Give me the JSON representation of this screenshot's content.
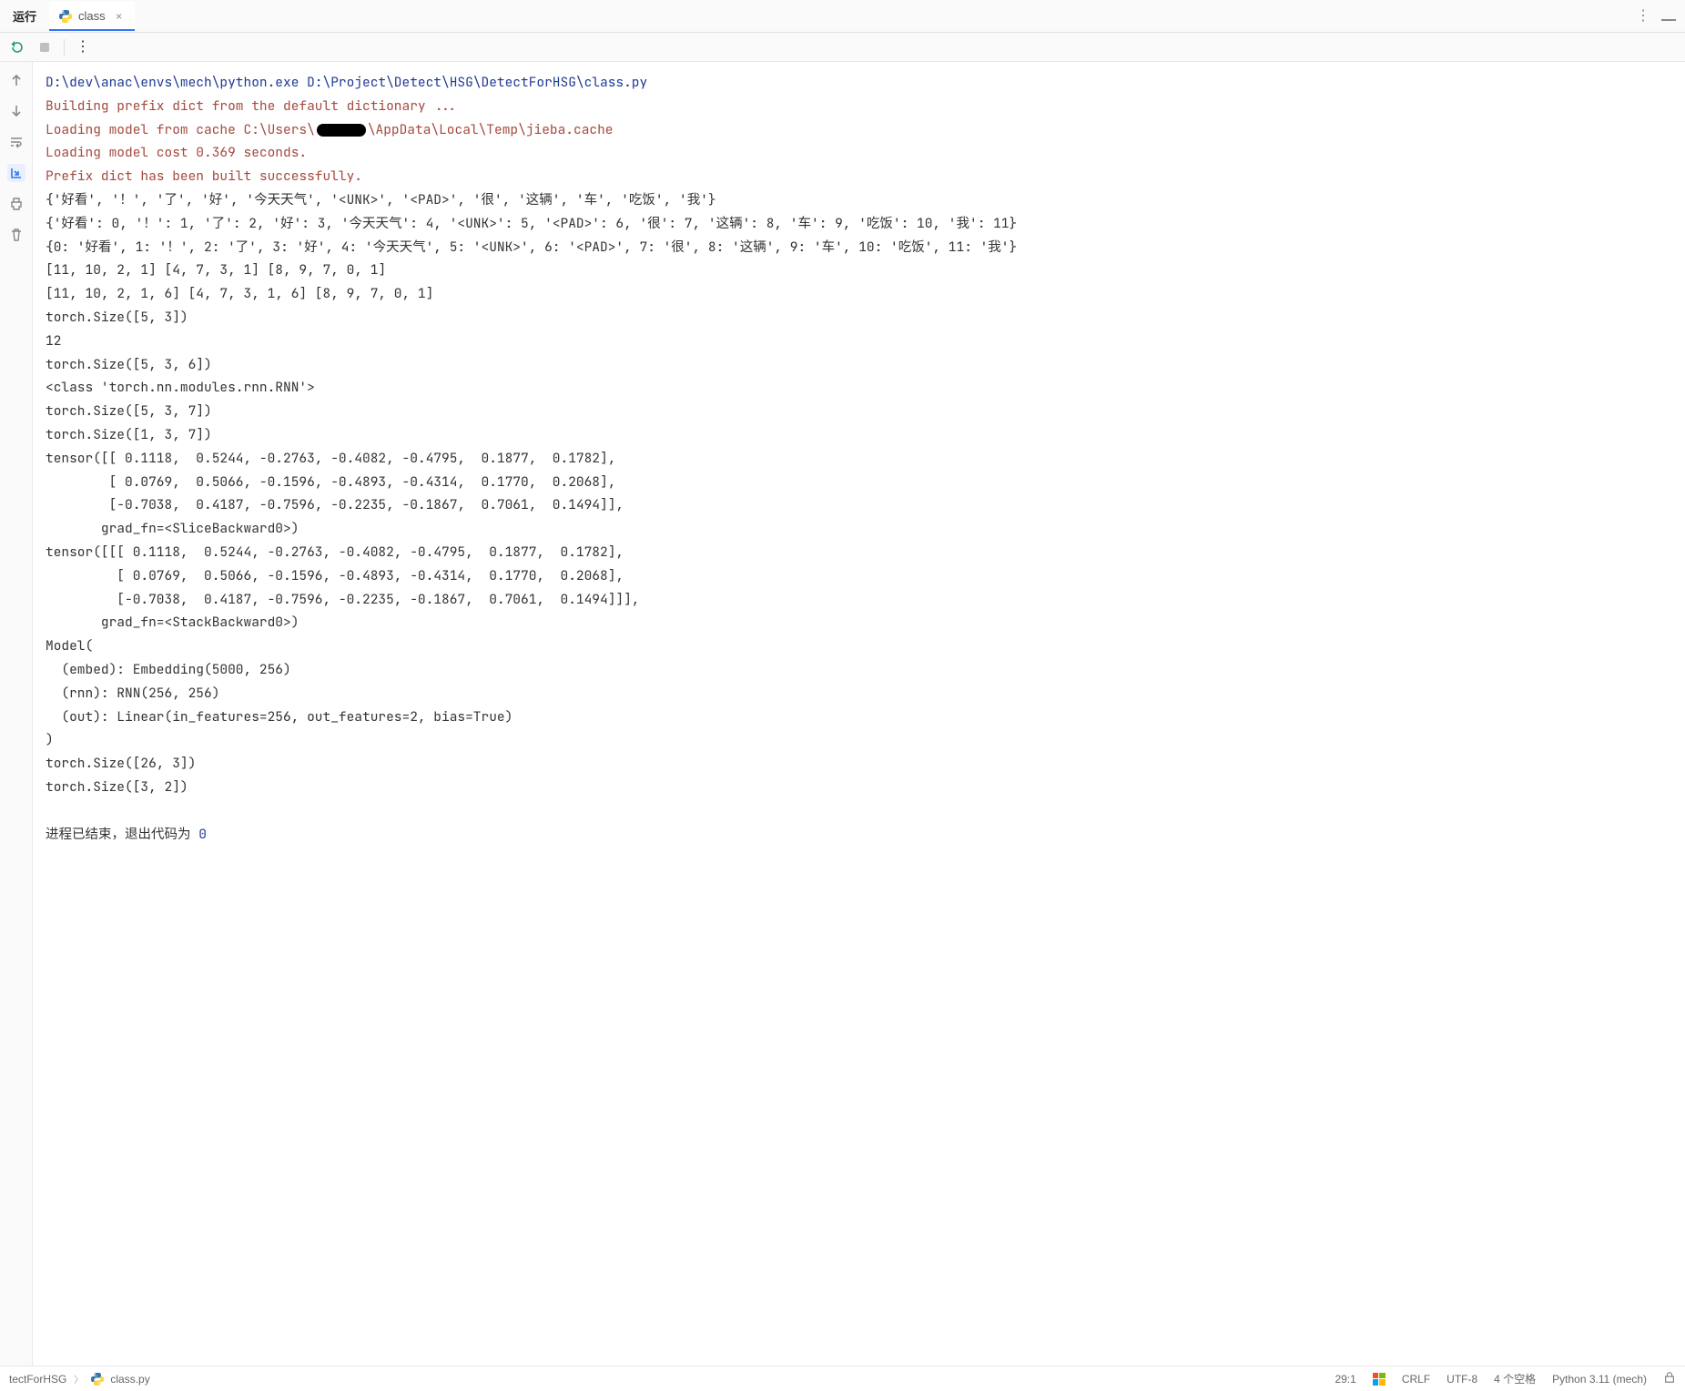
{
  "tabbar": {
    "run_label": "运行",
    "tab": {
      "title": "class",
      "close_glyph": "×"
    },
    "more_glyph": "⋮",
    "minimize_title": "—"
  },
  "toolbar": {
    "rerun_title": "Rerun",
    "stop_title": "Stop",
    "more_glyph": "⋮"
  },
  "gutter": {
    "up_title": "↑",
    "down_title": "↓",
    "wrap_title": "Soft-wrap",
    "scroll_title": "Scroll to end",
    "print_title": "Print",
    "delete_title": "Delete"
  },
  "console": {
    "cmd": "D:\\dev\\anac\\envs\\mech\\python.exe D:\\Project\\Detect\\HSG\\DetectForHSG\\class.py",
    "warn1": "Building prefix dict from the default dictionary ...",
    "warn2a": "Loading model from cache C:\\Users\\",
    "warn2b": "\\AppData\\Local\\Temp\\jieba.cache",
    "warn3": "Loading model cost 0.369 seconds.",
    "warn4": "Prefix dict has been built successfully.",
    "out": [
      "{'好看', '！', '了', '好', '今天天气', '<UNK>', '<PAD>', '很', '这辆', '车', '吃饭', '我'}",
      "{'好看': 0, '！': 1, '了': 2, '好': 3, '今天天气': 4, '<UNK>': 5, '<PAD>': 6, '很': 7, '这辆': 8, '车': 9, '吃饭': 10, '我': 11}",
      "{0: '好看', 1: '！', 2: '了', 3: '好', 4: '今天天气', 5: '<UNK>', 6: '<PAD>', 7: '很', 8: '这辆', 9: '车', 10: '吃饭', 11: '我'}",
      "[11, 10, 2, 1] [4, 7, 3, 1] [8, 9, 7, 0, 1]",
      "[11, 10, 2, 1, 6] [4, 7, 3, 1, 6] [8, 9, 7, 0, 1]",
      "torch.Size([5, 3])",
      "12",
      "torch.Size([5, 3, 6])",
      "<class 'torch.nn.modules.rnn.RNN'>",
      "torch.Size([5, 3, 7])",
      "torch.Size([1, 3, 7])",
      "tensor([[ 0.1118,  0.5244, -0.2763, -0.4082, -0.4795,  0.1877,  0.1782],",
      "        [ 0.0769,  0.5066, -0.1596, -0.4893, -0.4314,  0.1770,  0.2068],",
      "        [-0.7038,  0.4187, -0.7596, -0.2235, -0.1867,  0.7061,  0.1494]],",
      "       grad_fn=<SliceBackward0>)",
      "tensor([[[ 0.1118,  0.5244, -0.2763, -0.4082, -0.4795,  0.1877,  0.1782],",
      "         [ 0.0769,  0.5066, -0.1596, -0.4893, -0.4314,  0.1770,  0.2068],",
      "         [-0.7038,  0.4187, -0.7596, -0.2235, -0.1867,  0.7061,  0.1494]]],",
      "       grad_fn=<StackBackward0>)",
      "Model(",
      "  (embed): Embedding(5000, 256)",
      "  (rnn): RNN(256, 256)",
      "  (out): Linear(in_features=256, out_features=2, bias=True)",
      ")",
      "torch.Size([26, 3])",
      "torch.Size([3, 2])"
    ],
    "proc_prefix": "进程已结束，退出代码为 ",
    "proc_code": "0"
  },
  "status": {
    "breadcrumb1": "tectForHSG",
    "breadcrumb2": "class.py",
    "cursor": "29:1",
    "line_sep": "CRLF",
    "encoding": "UTF-8",
    "indent": "4 个空格",
    "interpreter": "Python 3.11 (mech)"
  }
}
